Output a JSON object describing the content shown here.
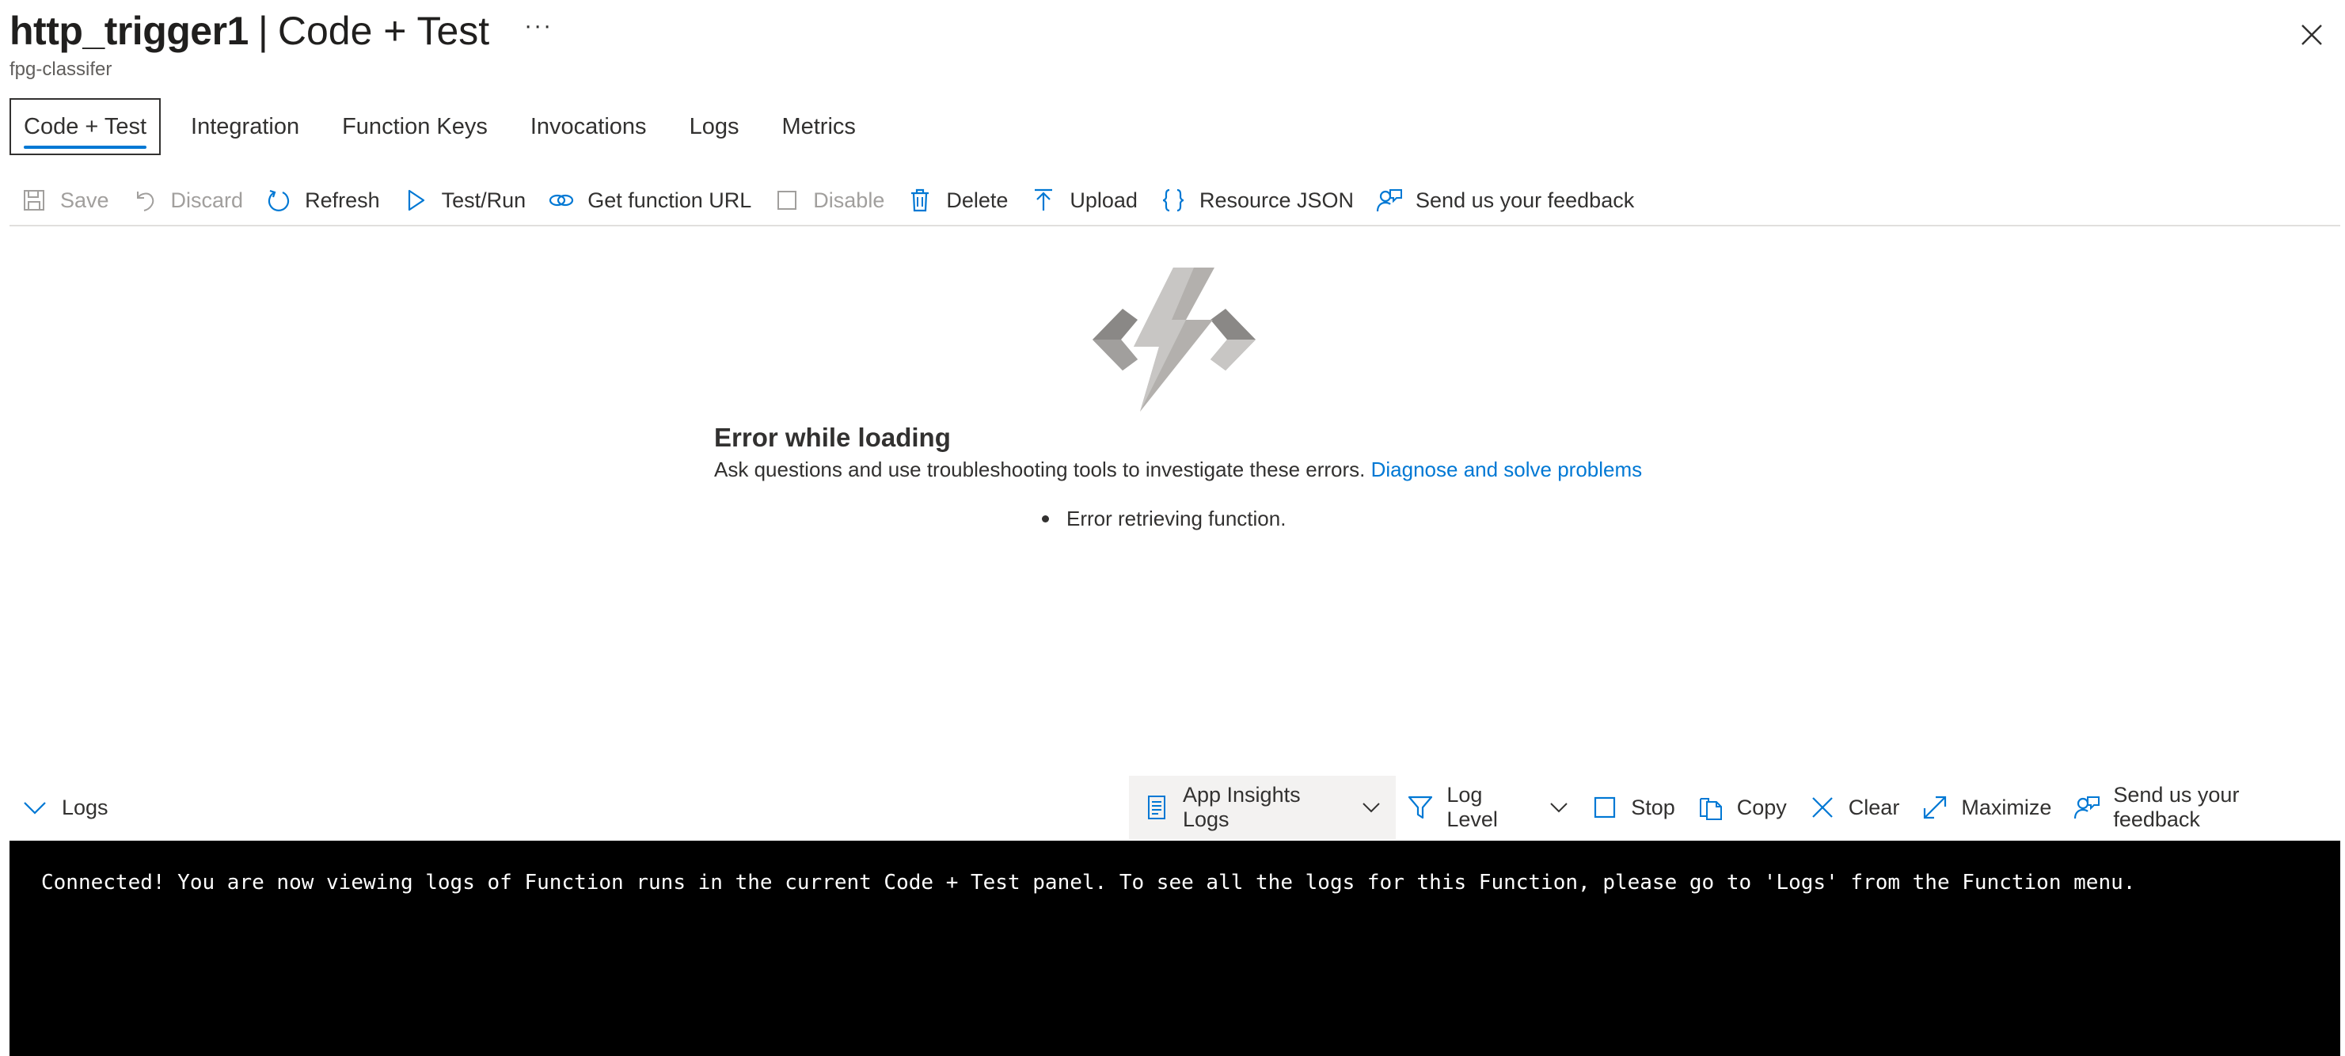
{
  "header": {
    "function_name": "http_trigger1",
    "separator": "|",
    "section": "Code + Test",
    "more": "···",
    "subtitle": "fpg-classifer"
  },
  "tabs": [
    {
      "label": "Code + Test",
      "active": true
    },
    {
      "label": "Integration"
    },
    {
      "label": "Function Keys"
    },
    {
      "label": "Invocations"
    },
    {
      "label": "Logs"
    },
    {
      "label": "Metrics"
    }
  ],
  "toolbar": {
    "save": "Save",
    "discard": "Discard",
    "refresh": "Refresh",
    "test_run": "Test/Run",
    "get_url": "Get function URL",
    "disable": "Disable",
    "delete": "Delete",
    "upload": "Upload",
    "resource_json": "Resource JSON",
    "feedback": "Send us your feedback"
  },
  "error": {
    "title": "Error while loading",
    "description": "Ask questions and use troubleshooting tools to investigate these errors.",
    "link": "Diagnose and solve problems",
    "items": [
      "Error retrieving function."
    ]
  },
  "logs_panel": {
    "toggle_label": "Logs",
    "app_insights": "App Insights Logs",
    "log_level": "Log Level",
    "stop": "Stop",
    "copy": "Copy",
    "clear": "Clear",
    "maximize": "Maximize",
    "feedback": "Send us your feedback",
    "console_text": "Connected! You are now viewing logs of Function runs in the current Code + Test panel. To see all the logs for this Function, please go to 'Logs' from the Function menu."
  },
  "colors": {
    "accent": "#0078d4",
    "text": "#323130",
    "disabled": "#a19f9d",
    "console_bg": "#000000"
  }
}
